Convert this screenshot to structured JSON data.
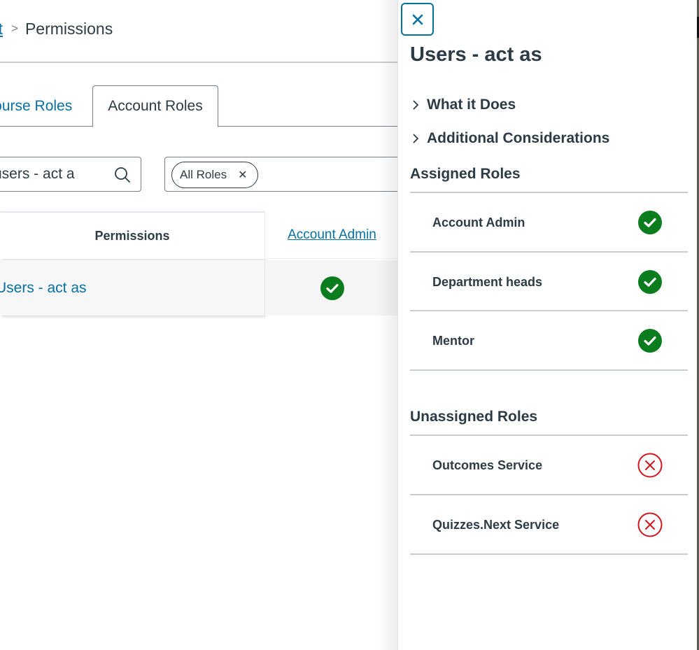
{
  "breadcrumb": {
    "parent_link": "Account",
    "separator": ">",
    "current": "Permissions"
  },
  "tabs": [
    {
      "label": "Course Roles",
      "selected": false
    },
    {
      "label": "Account Roles",
      "selected": true
    }
  ],
  "search": {
    "value": "users - act a",
    "icon": "search-icon"
  },
  "role_filter": {
    "selected_tag": "All Roles",
    "remove_icon": "close-icon"
  },
  "table": {
    "permissions_header": "Permissions",
    "columns": [
      "Account Admin"
    ],
    "rows": [
      {
        "permission": "Users - act as",
        "values": [
          "enabled"
        ]
      }
    ]
  },
  "tray": {
    "close_icon": "close-icon",
    "title": "Users - act as",
    "toggles": [
      {
        "label": "What it Does",
        "expanded": false
      },
      {
        "label": "Additional Considerations",
        "expanded": false
      }
    ],
    "assigned_heading": "Assigned Roles",
    "assigned_roles": [
      {
        "name": "Account Admin",
        "status": "enabled"
      },
      {
        "name": "Department heads",
        "status": "enabled"
      },
      {
        "name": "Mentor",
        "status": "enabled"
      }
    ],
    "unassigned_heading": "Unassigned Roles",
    "unassigned_roles": [
      {
        "name": "Outcomes Service",
        "status": "disabled"
      },
      {
        "name": "Quizzes.Next Service",
        "status": "disabled"
      }
    ]
  },
  "colors": {
    "link": "#0770a3",
    "text": "#2d3b45",
    "enabled": "#0b7d1e",
    "disabled": "#d0161e",
    "border": "#73818c",
    "divider": "#c7cdd1"
  }
}
